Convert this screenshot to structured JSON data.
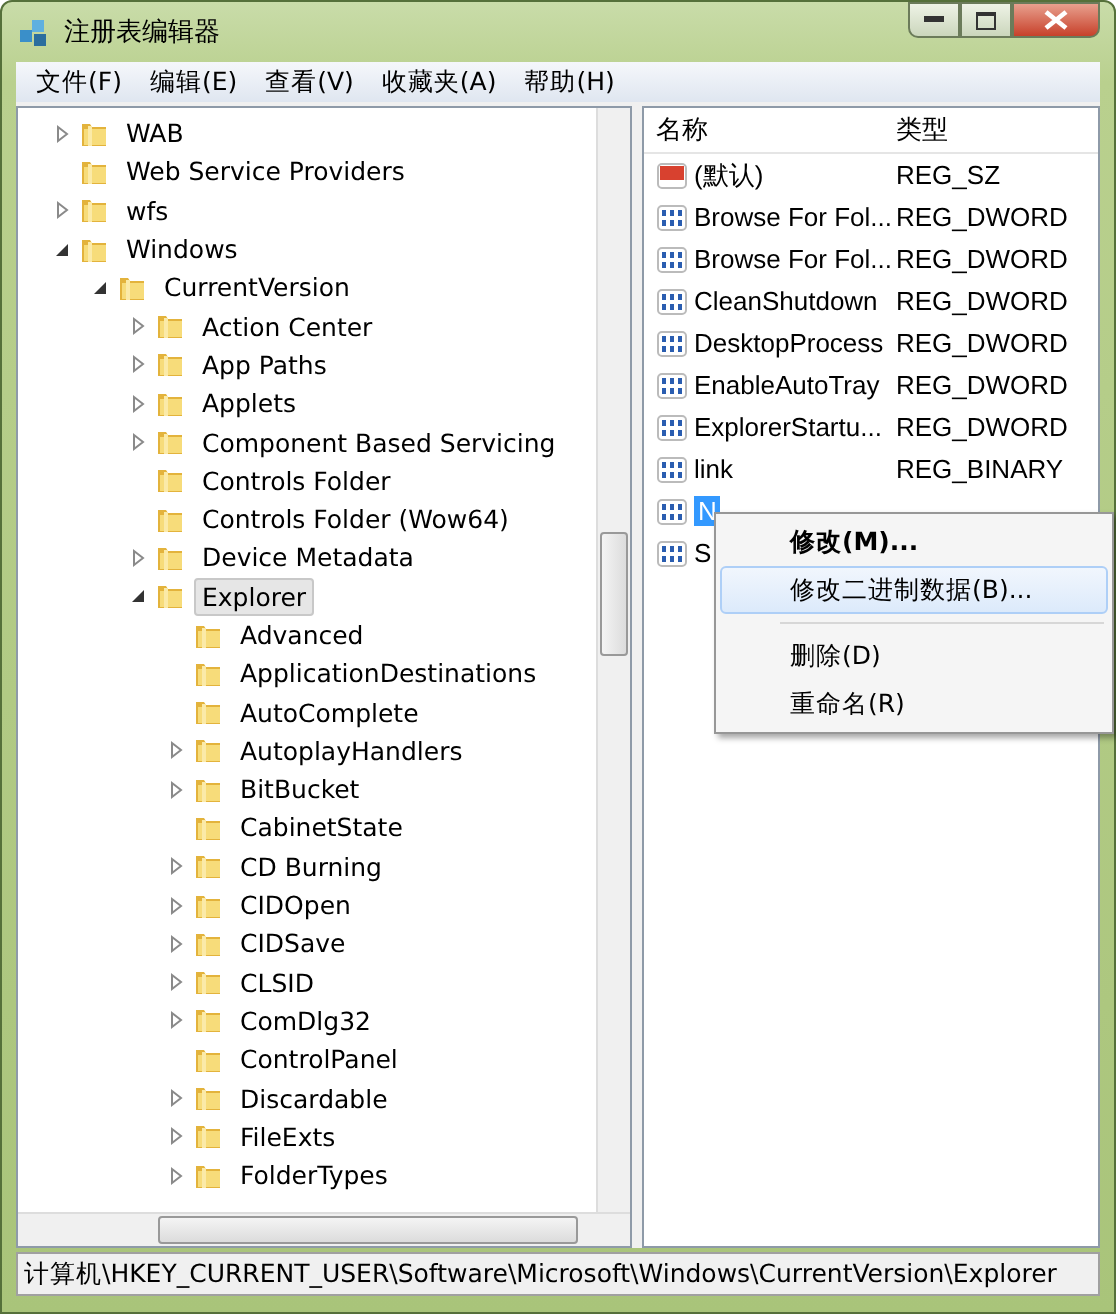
{
  "window": {
    "title": "注册表编辑器"
  },
  "menu": [
    "文件(F)",
    "编辑(E)",
    "查看(V)",
    "收藏夹(A)",
    "帮助(H)"
  ],
  "tree": [
    {
      "label": "WAB",
      "expanded": false,
      "selected": false
    },
    {
      "label": "Web Service Providers",
      "selected": false
    },
    {
      "label": "wfs",
      "expanded": false,
      "selected": false
    },
    {
      "label": "Windows",
      "expanded": true,
      "selected": false,
      "children": [
        {
          "label": "CurrentVersion",
          "expanded": true,
          "selected": false,
          "children": [
            {
              "label": "Action Center",
              "expanded": false,
              "selected": false
            },
            {
              "label": "App Paths",
              "expanded": false,
              "selected": false
            },
            {
              "label": "Applets",
              "expanded": false,
              "selected": false
            },
            {
              "label": "Component Based Servicing",
              "expanded": false,
              "selected": false
            },
            {
              "label": "Controls Folder",
              "selected": false
            },
            {
              "label": "Controls Folder (Wow64)",
              "selected": false
            },
            {
              "label": "Device Metadata",
              "expanded": false,
              "selected": false
            },
            {
              "label": "Explorer",
              "expanded": true,
              "selected": true,
              "children": [
                {
                  "label": "Advanced",
                  "selected": false
                },
                {
                  "label": "ApplicationDestinations",
                  "selected": false
                },
                {
                  "label": "AutoComplete",
                  "selected": false
                },
                {
                  "label": "AutoplayHandlers",
                  "expanded": false,
                  "selected": false
                },
                {
                  "label": "BitBucket",
                  "expanded": false,
                  "selected": false
                },
                {
                  "label": "CabinetState",
                  "selected": false
                },
                {
                  "label": "CD Burning",
                  "expanded": false,
                  "selected": false
                },
                {
                  "label": "CIDOpen",
                  "expanded": false,
                  "selected": false
                },
                {
                  "label": "CIDSave",
                  "expanded": false,
                  "selected": false
                },
                {
                  "label": "CLSID",
                  "expanded": false,
                  "selected": false
                },
                {
                  "label": "ComDlg32",
                  "expanded": false,
                  "selected": false
                },
                {
                  "label": "ControlPanel",
                  "selected": false
                },
                {
                  "label": "Discardable",
                  "expanded": false,
                  "selected": false
                },
                {
                  "label": "FileExts",
                  "expanded": false,
                  "selected": false
                },
                {
                  "label": "FolderTypes",
                  "expanded": false,
                  "selected": false
                }
              ]
            }
          ]
        }
      ]
    }
  ],
  "values": {
    "columns": [
      "名称",
      "类型"
    ],
    "rows": [
      {
        "kind": "string",
        "name": "(默认)",
        "type": "REG_SZ",
        "selected": false
      },
      {
        "kind": "binary",
        "name": "Browse For Fol...",
        "type": "REG_DWORD",
        "selected": false
      },
      {
        "kind": "binary",
        "name": "Browse For Fol...",
        "type": "REG_DWORD",
        "selected": false
      },
      {
        "kind": "binary",
        "name": "CleanShutdown",
        "type": "REG_DWORD",
        "selected": false
      },
      {
        "kind": "binary",
        "name": "DesktopProcess",
        "type": "REG_DWORD",
        "selected": false
      },
      {
        "kind": "binary",
        "name": "EnableAutoTray",
        "type": "REG_DWORD",
        "selected": false
      },
      {
        "kind": "binary",
        "name": "ExplorerStartu...",
        "type": "REG_DWORD",
        "selected": false
      },
      {
        "kind": "binary",
        "name": "link",
        "type": "REG_BINARY",
        "selected": false
      },
      {
        "kind": "binary",
        "name": "N",
        "selected": true
      },
      {
        "kind": "binary",
        "name": "S",
        "selected": false
      }
    ]
  },
  "context_menu": [
    {
      "kind": "item",
      "label": "修改(M)...",
      "default": true,
      "selected": false
    },
    {
      "kind": "item",
      "label": "修改二进制数据(B)...",
      "default": false,
      "selected": true
    },
    {
      "kind": "separator"
    },
    {
      "kind": "item",
      "label": "删除(D)",
      "default": false,
      "selected": false
    },
    {
      "kind": "item",
      "label": "重命名(R)",
      "default": false,
      "selected": false
    }
  ],
  "status_bar": "计算机\\HKEY_CURRENT_USER\\Software\\Microsoft\\Windows\\CurrentVersion\\Explorer"
}
